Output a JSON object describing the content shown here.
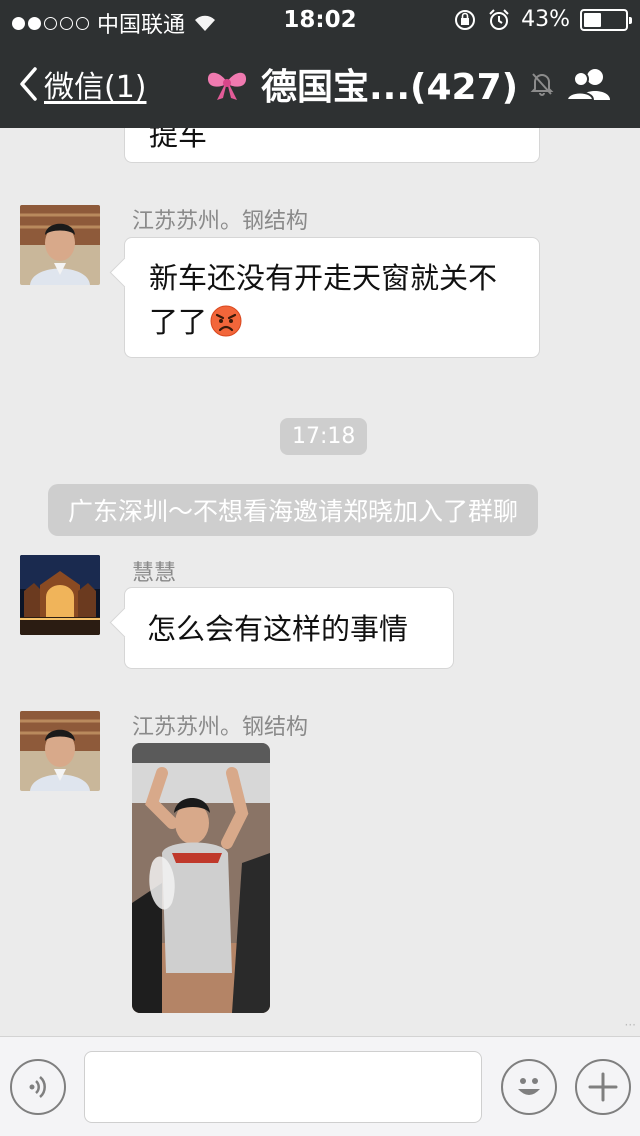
{
  "status_bar": {
    "carrier": "中国联通",
    "time": "18:02",
    "battery": "43%",
    "battery_level": 0.43
  },
  "nav": {
    "back_label": "微信(1)",
    "chat_title": "德国宝...(427)",
    "title_icon": "bow-icon",
    "mute_icon": "mute-bell-icon",
    "right_icon": "group-people-icon"
  },
  "messages": {
    "partial_top_text": "提车",
    "msg1": {
      "sender": "江苏苏州。钢结构",
      "text": "新车还没有开走天窗就关不了了"
    },
    "time_divider": "17:18",
    "system_notice": "广东深圳～不想看海邀请郑晓加入了群聊",
    "msg2": {
      "sender": "慧慧",
      "text": "怎么会有这样的事情"
    },
    "msg3": {
      "sender": "江苏苏州。钢结构",
      "attachment": "photo"
    }
  },
  "input_bar": {
    "voice_icon": "voice-icon",
    "emoji_icon": "smiley-icon",
    "plus_icon": "plus-icon",
    "text_value": ""
  }
}
